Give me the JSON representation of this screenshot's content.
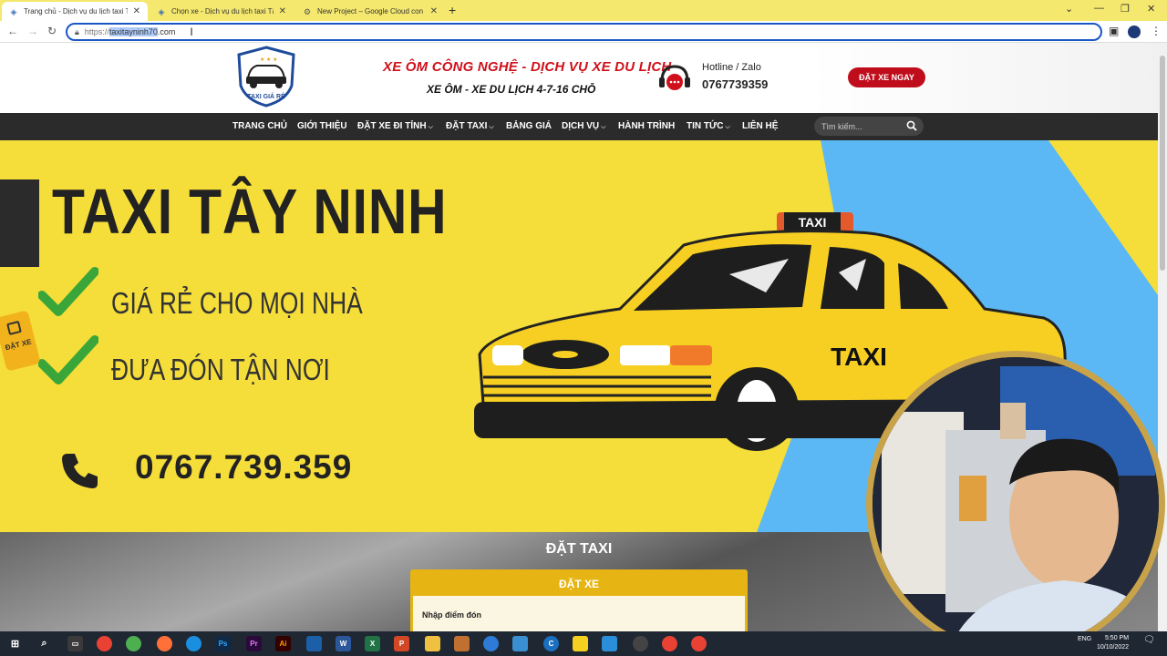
{
  "browser": {
    "tabs": [
      {
        "title": "Trang chủ - Dịch vụ du lịch taxi Tây",
        "active": true
      },
      {
        "title": "Chọn xe - Dịch vụ du lịch taxi Tây",
        "active": false
      },
      {
        "title": "New Project – Google Cloud con",
        "active": false
      }
    ],
    "new_tab": "+",
    "url_protocol": "https://",
    "url_host": "taxitayninh70",
    "url_tld": ".com"
  },
  "header": {
    "logo_text": "TAXI GIÁ RẺ",
    "slogan_main": "XE ÔM CÔNG NGHỆ - DỊCH VỤ XE DU LỊCH",
    "slogan_sub": "XE ÔM - XE DU LỊCH 4-7-16 CHỖ",
    "hotline_label": "Hotline / Zalo",
    "hotline_number": "0767739359",
    "book_now": "ĐẶT XE NGAY"
  },
  "nav": {
    "items": [
      {
        "label": "TRANG CHỦ",
        "has_dropdown": false
      },
      {
        "label": "GIỚI THIỆU",
        "has_dropdown": false
      },
      {
        "label": "ĐẶT XE ĐI TỈNH",
        "has_dropdown": true
      },
      {
        "label": "ĐẶT TAXI",
        "has_dropdown": true
      },
      {
        "label": "BẢNG GIÁ",
        "has_dropdown": false
      },
      {
        "label": "DỊCH VỤ",
        "has_dropdown": true
      },
      {
        "label": "HÀNH TRÌNH",
        "has_dropdown": false
      },
      {
        "label": "TIN TỨC",
        "has_dropdown": true
      },
      {
        "label": "LIÊN HỆ",
        "has_dropdown": false
      }
    ],
    "search_placeholder": "Tìm kiếm..."
  },
  "hero": {
    "title": "TAXI TÂY NINH",
    "point1": "GIÁ RẺ CHO MỌI NHÀ",
    "point2": "ĐƯA ĐÓN TẬN NƠI",
    "phone": "0767.739.359",
    "taxi_sign": "TAXI",
    "taxi_door": "TAXI",
    "sticker": "ĐẶT XE"
  },
  "booking": {
    "section_title": "ĐẶT TAXI",
    "card_title": "ĐẶT XE",
    "pickup_label": "Nhập điểm đón"
  },
  "taskbar": {
    "lang": "ENG",
    "time": "5:50 PM",
    "date": "10/10/2022"
  },
  "colors": {
    "banner_yellow": "#f5dd3a",
    "banner_blue": "#5bb8f5",
    "brand_red": "#c00d1c",
    "nav_dark": "#2b2b2b",
    "accent_gold": "#e6b513"
  }
}
